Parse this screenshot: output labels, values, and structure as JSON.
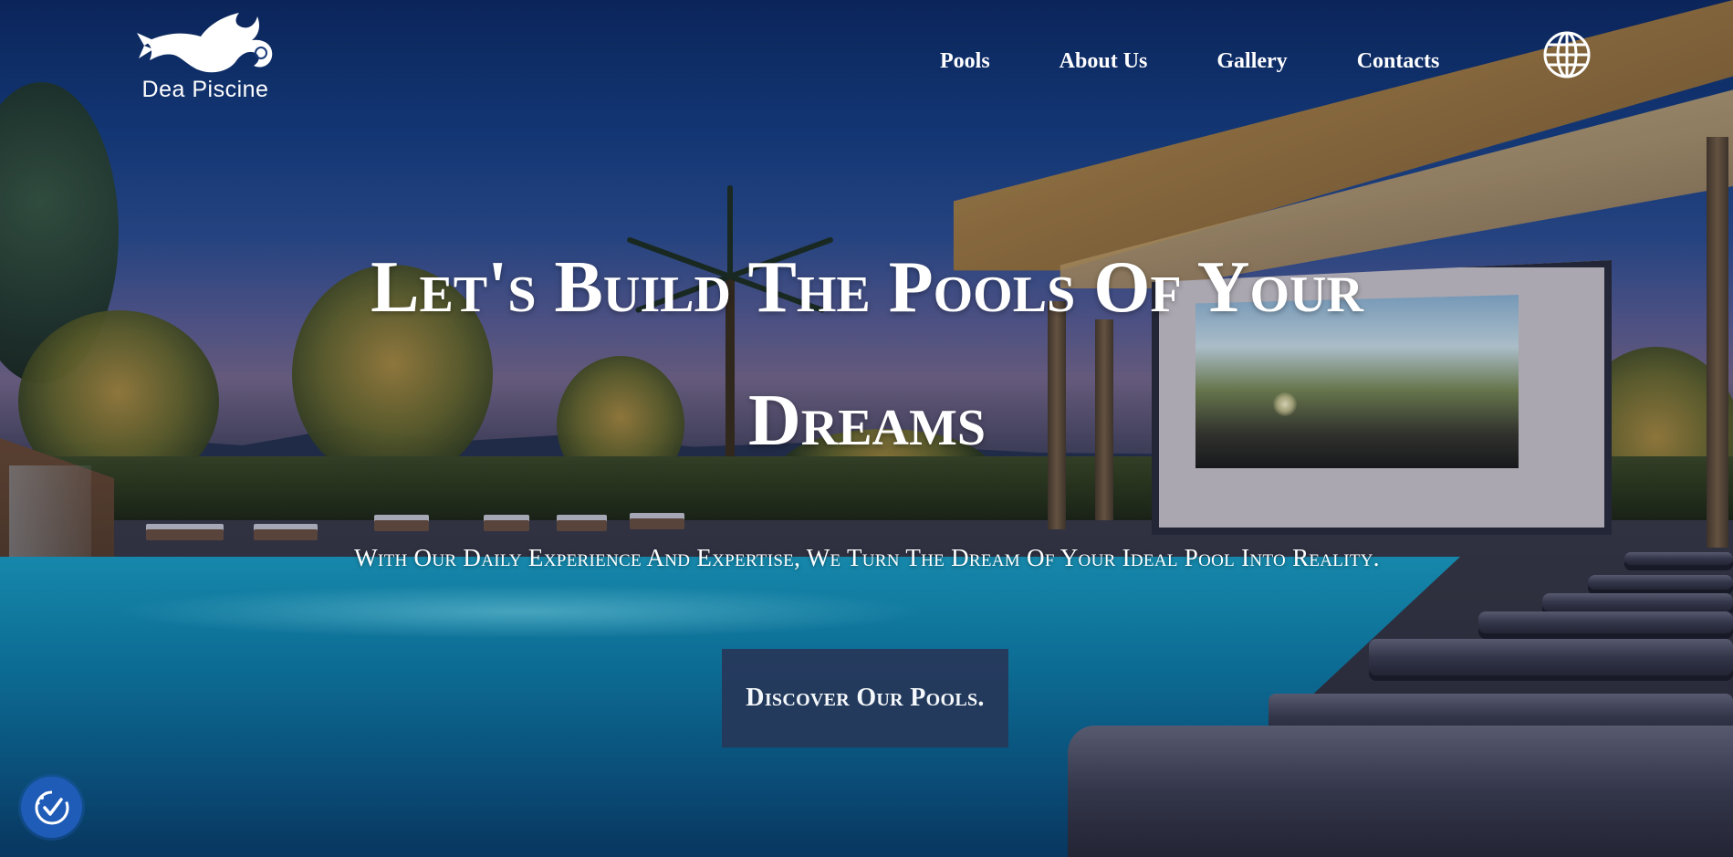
{
  "brand": {
    "name": "Dea Piscine"
  },
  "nav": {
    "items": [
      {
        "label": "Pools"
      },
      {
        "label": "About Us"
      },
      {
        "label": "Gallery"
      },
      {
        "label": "Contacts"
      }
    ],
    "language_icon": "globe-icon"
  },
  "hero": {
    "title_line1": "Let's Build The Pools Of Your",
    "title_line2": "Dreams",
    "subtitle": "With Our Daily Experience And Expertise, We Turn The Dream Of Your Ideal Pool Into Reality.",
    "cta_label": "Discover Our Pools."
  },
  "accessibility": {
    "icon": "accessibility-icon"
  },
  "colors": {
    "text": "#ffffff",
    "cta_background": "#26395c",
    "accessibility_button": "#1f5cb8",
    "sky": "#163f85",
    "pool_water": "#1aa2c8"
  }
}
